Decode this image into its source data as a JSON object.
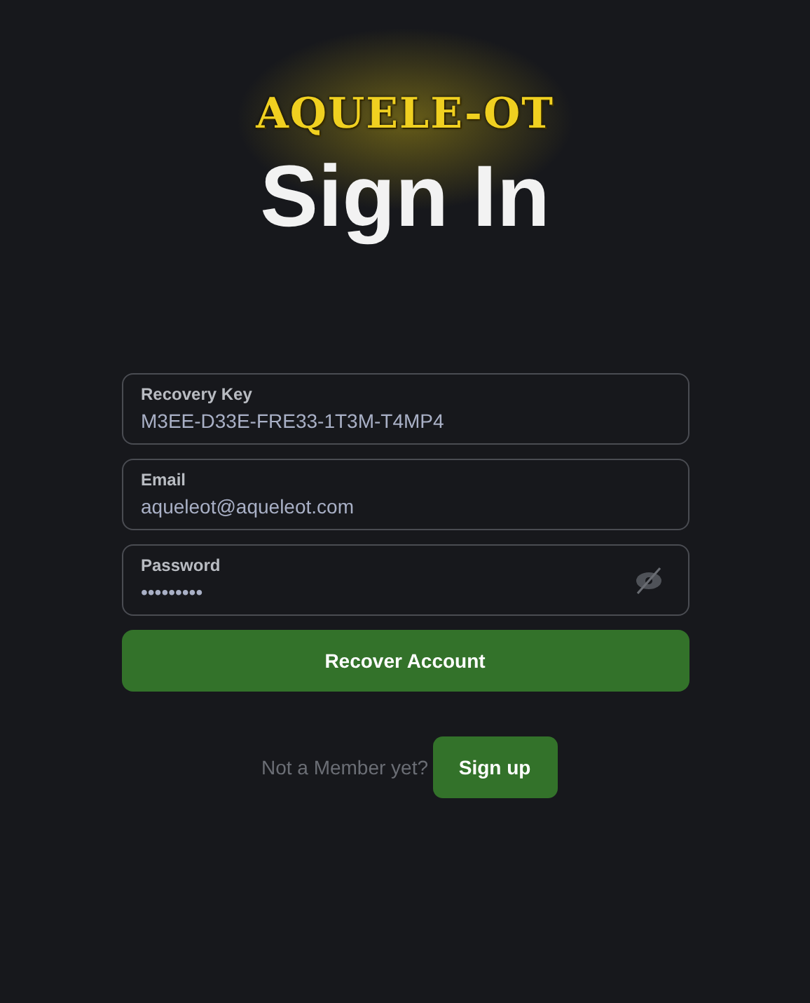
{
  "logo": "AQUELE-OT",
  "title": "Sign In",
  "fields": [
    {
      "kind": "text",
      "label": "Recovery Key",
      "value": "M3EE-D33E-FRE33-1T3M-T4MP4"
    },
    {
      "kind": "text",
      "label": "Email",
      "value": "aqueleot@aqueleot.com"
    },
    {
      "kind": "password",
      "label": "Password",
      "value": "•••••••••"
    }
  ],
  "submit_button": "Recover Account",
  "signup": {
    "prompt": "Not a Member yet?",
    "button": "Sign up"
  }
}
